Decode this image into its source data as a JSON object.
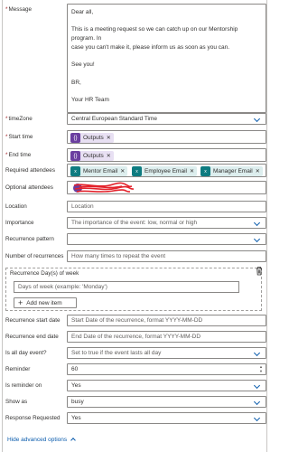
{
  "message": {
    "label": "Message",
    "lines": [
      "Dear all,",
      "",
      "This is a meeting request so we can catch up on our Mentorship program. In",
      "case you can't make it, please inform us as soon as you can.",
      "",
      "See you!",
      "",
      "BR,",
      "",
      "Your HR Team"
    ]
  },
  "timezone": {
    "label": "timeZone",
    "value": "Central European Standard Time"
  },
  "start_time": {
    "label": "Start time",
    "token": "Outputs"
  },
  "end_time": {
    "label": "End time",
    "token": "Outputs"
  },
  "required_attendees": {
    "label": "Required attendees",
    "tokens": [
      "Mentor Email",
      "Employee Email",
      "Manager Email"
    ]
  },
  "optional_attendees": {
    "label": "Optional attendees"
  },
  "location": {
    "label": "Location",
    "placeholder": "Location"
  },
  "importance": {
    "label": "Importance",
    "placeholder": "The importance of the event: low, normal or high"
  },
  "recurrence_pattern": {
    "label": "Recurrence pattern",
    "value": ""
  },
  "number_of_recurrences": {
    "label": "Number of recurrences",
    "placeholder": "How many times to repeat the event"
  },
  "recurrence_days": {
    "label": "Recurrence Day(s) of week",
    "placeholder": "Days of week (example: 'Monday')",
    "add_label": "Add new item"
  },
  "recurrence_start_date": {
    "label": "Recurrence start date",
    "placeholder": "Start Date of the recurrence, format YYYY-MM-DD"
  },
  "recurrence_end_date": {
    "label": "Recurrence end date",
    "placeholder": "End Date of the recurrence, format YYYY-MM-DD"
  },
  "is_all_day": {
    "label": "Is all day event?",
    "placeholder": "Set to true if the event lasts all day"
  },
  "reminder": {
    "label": "Reminder",
    "value": "60"
  },
  "is_reminder_on": {
    "label": "Is reminder on",
    "value": "Yes"
  },
  "show_as": {
    "label": "Show as",
    "value": "busy"
  },
  "response_requested": {
    "label": "Response Requested",
    "value": "Yes"
  },
  "advanced_toggle": "Hide advanced options",
  "colors": {
    "accent": "#0b5cad",
    "required": "#a4262c",
    "token_purple": "#6b3fa0",
    "token_teal": "#0e7b80"
  }
}
